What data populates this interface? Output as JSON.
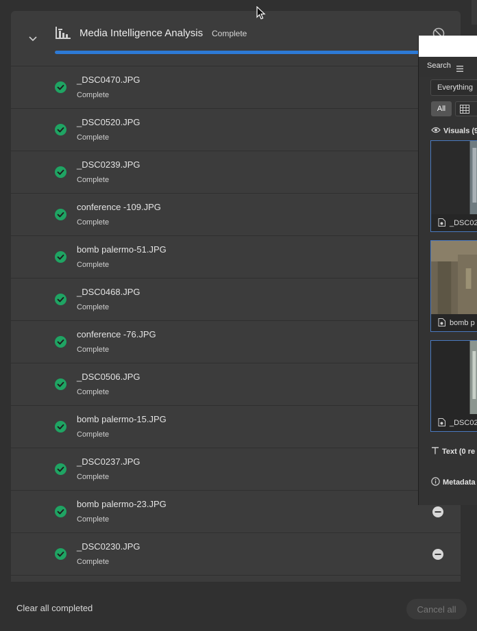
{
  "job": {
    "title": "Media Intelligence Analysis",
    "status": "Complete",
    "progress_percent": 100
  },
  "files": [
    {
      "name": "_DSC0470.JPG",
      "status": "Complete"
    },
    {
      "name": "_DSC0520.JPG",
      "status": "Complete"
    },
    {
      "name": "_DSC0239.JPG",
      "status": "Complete"
    },
    {
      "name": "conference -109.JPG",
      "status": "Complete"
    },
    {
      "name": "bomb palermo-51.JPG",
      "status": "Complete"
    },
    {
      "name": "_DSC0468.JPG",
      "status": "Complete"
    },
    {
      "name": "conference -76.JPG",
      "status": "Complete"
    },
    {
      "name": "_DSC0506.JPG",
      "status": "Complete"
    },
    {
      "name": "bomb palermo-15.JPG",
      "status": "Complete"
    },
    {
      "name": "_DSC0237.JPG",
      "status": "Complete"
    },
    {
      "name": "bomb palermo-23.JPG",
      "status": "Complete"
    },
    {
      "name": "_DSC0230.JPG",
      "status": "Complete"
    }
  ],
  "footer": {
    "clear_label": "Clear all completed",
    "cancel_all_label": "Cancel all"
  },
  "search_panel": {
    "tab_label": "Search",
    "scope_value": "Everything",
    "filter_all_label": "All",
    "visuals_label": "Visuals (9",
    "results": [
      {
        "label": "_DSC02"
      },
      {
        "label": "bomb p"
      },
      {
        "label": "_DSC02"
      }
    ],
    "text_label": "Text (0 re",
    "metadata_label": "Metadata"
  },
  "colors": {
    "accent": "#2d7ad6",
    "success": "#1fa463",
    "panel_bg": "#3c3c3c",
    "page_bg": "#303030"
  }
}
